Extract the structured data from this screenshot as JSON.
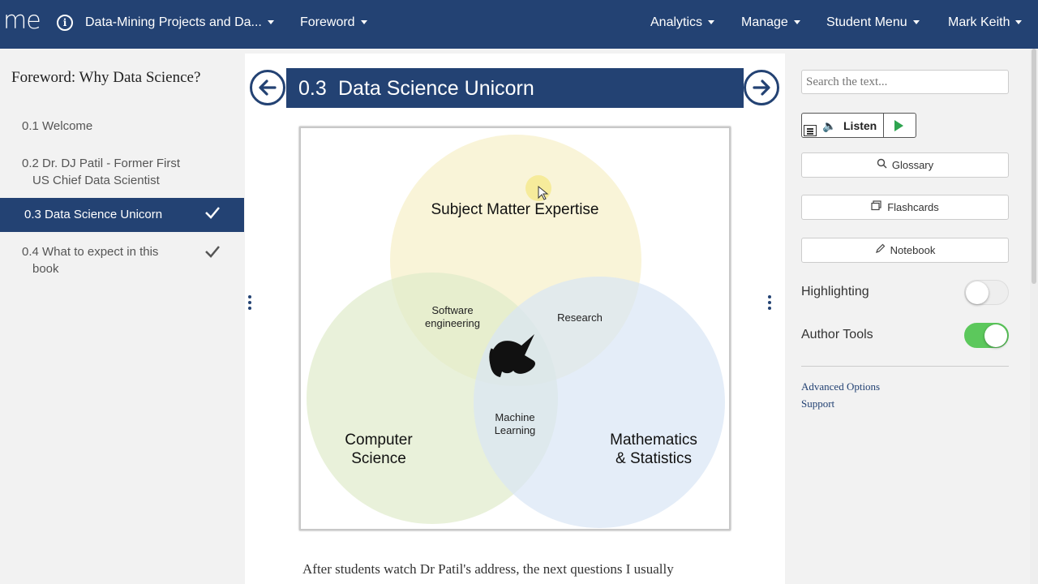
{
  "nav": {
    "logo": "me",
    "info_icon": "info-icon",
    "book_title": "Data-Mining Projects and Da...",
    "chapter": "Foreword",
    "analytics": "Analytics",
    "manage": "Manage",
    "student_menu": "Student Menu",
    "user": "Mark Keith"
  },
  "sidebar": {
    "title": "Foreword: Why Data Science?",
    "items": [
      {
        "line1": "0.1 Welcome",
        "line2": "",
        "completed": false
      },
      {
        "line1": "0.2 Dr. DJ Patil - Former First",
        "line2": "US Chief Data Scientist",
        "completed": false
      },
      {
        "line1": "0.3 Data Science Unicorn",
        "line2": "",
        "completed": true,
        "active": true
      },
      {
        "line1": "0.4 What to expect in this",
        "line2": "book",
        "completed": true
      }
    ]
  },
  "section": {
    "number": "0.3",
    "title": "Data Science Unicorn",
    "prev_icon": "arrow-left-icon",
    "next_icon": "arrow-right-icon"
  },
  "venn": {
    "top": "Subject Matter Expertise",
    "left_line1": "Computer",
    "left_line2": "Science",
    "right_line1": "Mathematics",
    "right_line2": "& Statistics",
    "top_left_line1": "Software",
    "top_left_line2": "engineering",
    "top_right": "Research",
    "bottom_line1": "Machine",
    "bottom_line2": "Learning",
    "center_icon": "unicorn-icon",
    "colors": {
      "top": "#f7efc8",
      "left": "#dfebcb",
      "right": "#d8e6f5"
    }
  },
  "content": {
    "paragraph": "After students watch Dr Patil's address, the next questions I usually"
  },
  "panel": {
    "search_placeholder": "Search the text...",
    "listen": "Listen",
    "glossary": "Glossary",
    "flashcards": "Flashcards",
    "notebook": "Notebook",
    "highlighting": "Highlighting",
    "highlighting_on": false,
    "author_tools": "Author Tools",
    "author_tools_on": true,
    "advanced_options": "Advanced Options",
    "support": "Support"
  },
  "colors": {
    "brand": "#234273",
    "toggle_on": "#5cc85c",
    "play": "#2ea44f"
  }
}
